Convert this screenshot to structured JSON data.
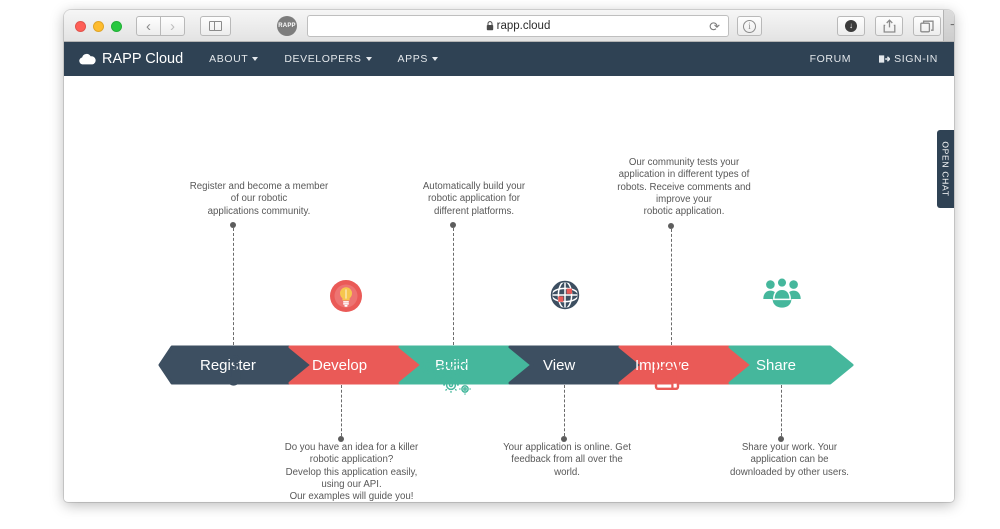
{
  "browser": {
    "url": "rapp.cloud",
    "lock_icon": "lock-icon",
    "favicon_label": "RAPP",
    "back_icon": "chevron-left-icon",
    "forward_icon": "chevron-right-icon",
    "sidebar_icon": "sidebar-toggle-icon",
    "reload_icon": "reload-icon",
    "info_icon": "info-icon",
    "download_icon": "download-icon",
    "share_icon": "share-icon",
    "tabs_icon": "tab-overview-icon",
    "newtab_icon": "plus-icon",
    "back_glyph": "‹",
    "forward_glyph": "›",
    "reload_glyph": "⟳",
    "info_glyph": "i",
    "download_glyph": "↓",
    "newtab_glyph": "+",
    "lock_glyph": "🔒"
  },
  "navbar": {
    "brand": "RAPP Cloud",
    "brand_icon": "cloud-icon",
    "items": [
      {
        "label": "ABOUT",
        "has_caret": true
      },
      {
        "label": "DEVELOPERS",
        "has_caret": true
      },
      {
        "label": "APPS",
        "has_caret": true
      }
    ],
    "right_items": [
      {
        "label": "FORUM",
        "icon": ""
      },
      {
        "label": "SIGN-IN",
        "icon": "sign-in-icon"
      }
    ]
  },
  "side_tab": {
    "label": "OPEN CHAT"
  },
  "pipeline": {
    "steps": [
      {
        "label": "Register",
        "color": "#3d4f61",
        "caption_position": "top",
        "caption_lines": [
          "Register and become a member",
          "of our robotic",
          "applications community."
        ],
        "icon": "click-hand-icon",
        "icon_position": "bottom",
        "icon_color": "#3d4f61"
      },
      {
        "label": "Develop",
        "color": "#ea5a57",
        "caption_position": "bottom",
        "caption_lines": [
          "Do you have an idea for a killer",
          "robotic application?",
          "Develop this application easily,",
          "using our API.",
          "Our examples will guide you!"
        ],
        "icon": "lightbulb-icon",
        "icon_position": "top",
        "icon_color": "#ea5a57"
      },
      {
        "label": "Build",
        "color": "#45b79c",
        "caption_position": "top",
        "caption_lines": [
          "Automatically build your",
          "robotic application for",
          "different platforms."
        ],
        "icon": "gears-icon",
        "icon_position": "bottom",
        "icon_color": "#45b79c"
      },
      {
        "label": "View",
        "color": "#3d4f61",
        "caption_position": "bottom",
        "caption_lines": [
          "Your application is online. Get",
          "feedback from all over the",
          "world."
        ],
        "icon": "globe-icon",
        "icon_position": "top",
        "icon_color": "#3d4f61"
      },
      {
        "label": "Improve",
        "color": "#ea5a57",
        "caption_position": "top",
        "caption_lines": [
          "Our community tests your",
          "application in different types of",
          "robots. Receive comments and",
          "improve your",
          "robotic application."
        ],
        "icon": "clipboard-icon",
        "icon_position": "bottom",
        "icon_color": "#ea5a57"
      },
      {
        "label": "Share",
        "color": "#45b79c",
        "caption_position": "bottom",
        "caption_lines": [
          "Share your work. Your",
          "application can be",
          "downloaded by other users."
        ],
        "icon": "people-group-icon",
        "icon_position": "top",
        "icon_color": "#45b79c"
      }
    ]
  },
  "colors": {
    "navy": "#2f4254",
    "chevron_navy": "#3d4f61",
    "red": "#ea5a57",
    "teal": "#45b79c",
    "page_bg": "#ffffff",
    "caption_text": "#585858"
  }
}
